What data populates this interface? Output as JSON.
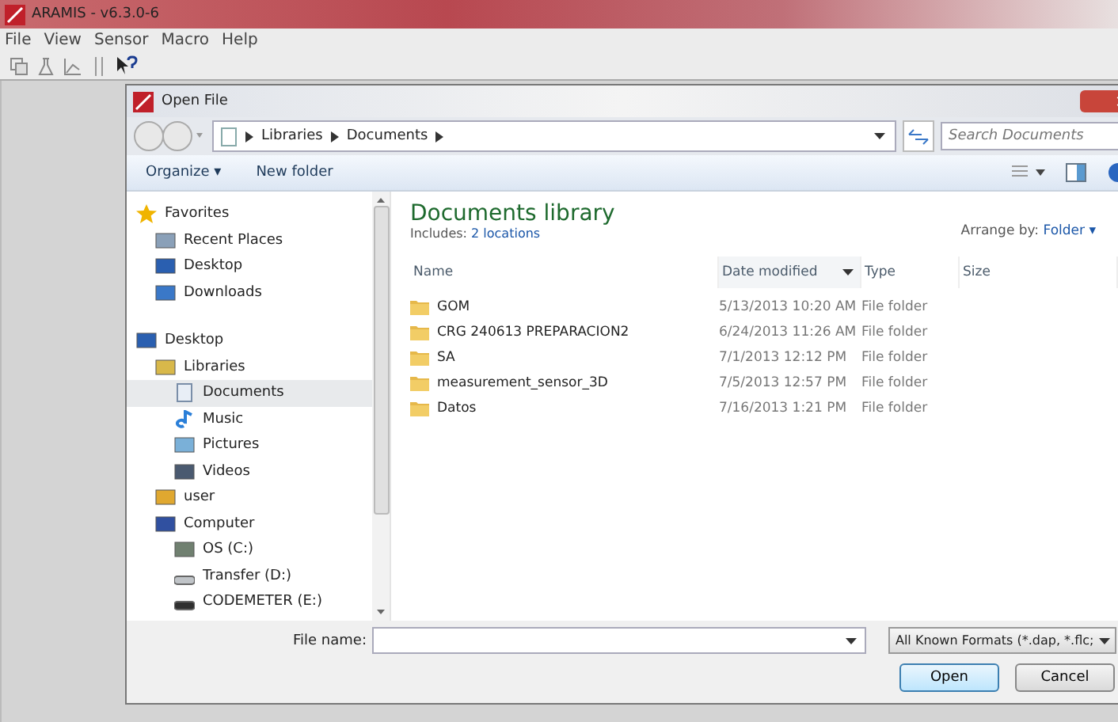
{
  "app": {
    "title": "ARAMIS - v6.3.0-6",
    "menu": [
      "File",
      "View",
      "Sensor",
      "Macro",
      "Help"
    ]
  },
  "dialog": {
    "title": "Open File",
    "breadcrumb": [
      "Libraries",
      "Documents"
    ],
    "search": {
      "placeholder": "Search Documents"
    },
    "toolbar": {
      "organize": "Organize ▾",
      "new_folder": "New folder"
    },
    "nav": [
      {
        "label": "Favorites",
        "kind": "star",
        "selected": false,
        "children": [
          {
            "label": "Recent Places",
            "kind": "recent",
            "selected": false
          },
          {
            "label": "Desktop",
            "kind": "desktop",
            "selected": false
          },
          {
            "label": "Downloads",
            "kind": "downloads",
            "selected": false
          }
        ]
      },
      {
        "label": "Desktop",
        "kind": "desktop",
        "selected": false,
        "children": [
          {
            "label": "Libraries",
            "kind": "libraries",
            "selected": false,
            "children": [
              {
                "label": "Documents",
                "kind": "document",
                "selected": true
              },
              {
                "label": "Music",
                "kind": "music",
                "selected": false
              },
              {
                "label": "Pictures",
                "kind": "pictures",
                "selected": false
              },
              {
                "label": "Videos",
                "kind": "videos",
                "selected": false
              }
            ]
          },
          {
            "label": "user",
            "kind": "user",
            "selected": false
          },
          {
            "label": "Computer",
            "kind": "computer",
            "selected": false,
            "children": [
              {
                "label": "OS (C:)",
                "kind": "osdrive",
                "selected": false
              },
              {
                "label": "Transfer (D:)",
                "kind": "drive",
                "selected": false
              },
              {
                "label": "CODEMETER (E:)",
                "kind": "usb",
                "selected": false
              }
            ]
          }
        ]
      }
    ],
    "library": {
      "title": "Documents library",
      "includes_label": "Includes:",
      "includes_link": "2 locations",
      "arrange_label": "Arrange by:",
      "arrange_value": "Folder ▾"
    },
    "columns": [
      {
        "label": "Name",
        "sorted": false
      },
      {
        "label": "Date modified",
        "sorted": true
      },
      {
        "label": "Type",
        "sorted": false
      },
      {
        "label": "Size",
        "sorted": false
      }
    ],
    "rows": [
      {
        "name": "GOM",
        "date": "5/13/2013 10:20 AM",
        "type": "File folder"
      },
      {
        "name": "CRG 240613 PREPARACION2",
        "date": "6/24/2013 11:26 AM",
        "type": "File folder"
      },
      {
        "name": "SA",
        "date": "7/1/2013 12:12 PM",
        "type": "File folder"
      },
      {
        "name": "measurement_sensor_3D",
        "date": "7/5/2013 12:57 PM",
        "type": "File folder"
      },
      {
        "name": "Datos",
        "date": "7/16/2013 1:21 PM",
        "type": "File folder"
      }
    ],
    "file_name_label": "File name:",
    "filter": "All Known Formats (*.dap, *.flc;",
    "buttons": [
      "Open",
      "Cancel"
    ]
  }
}
